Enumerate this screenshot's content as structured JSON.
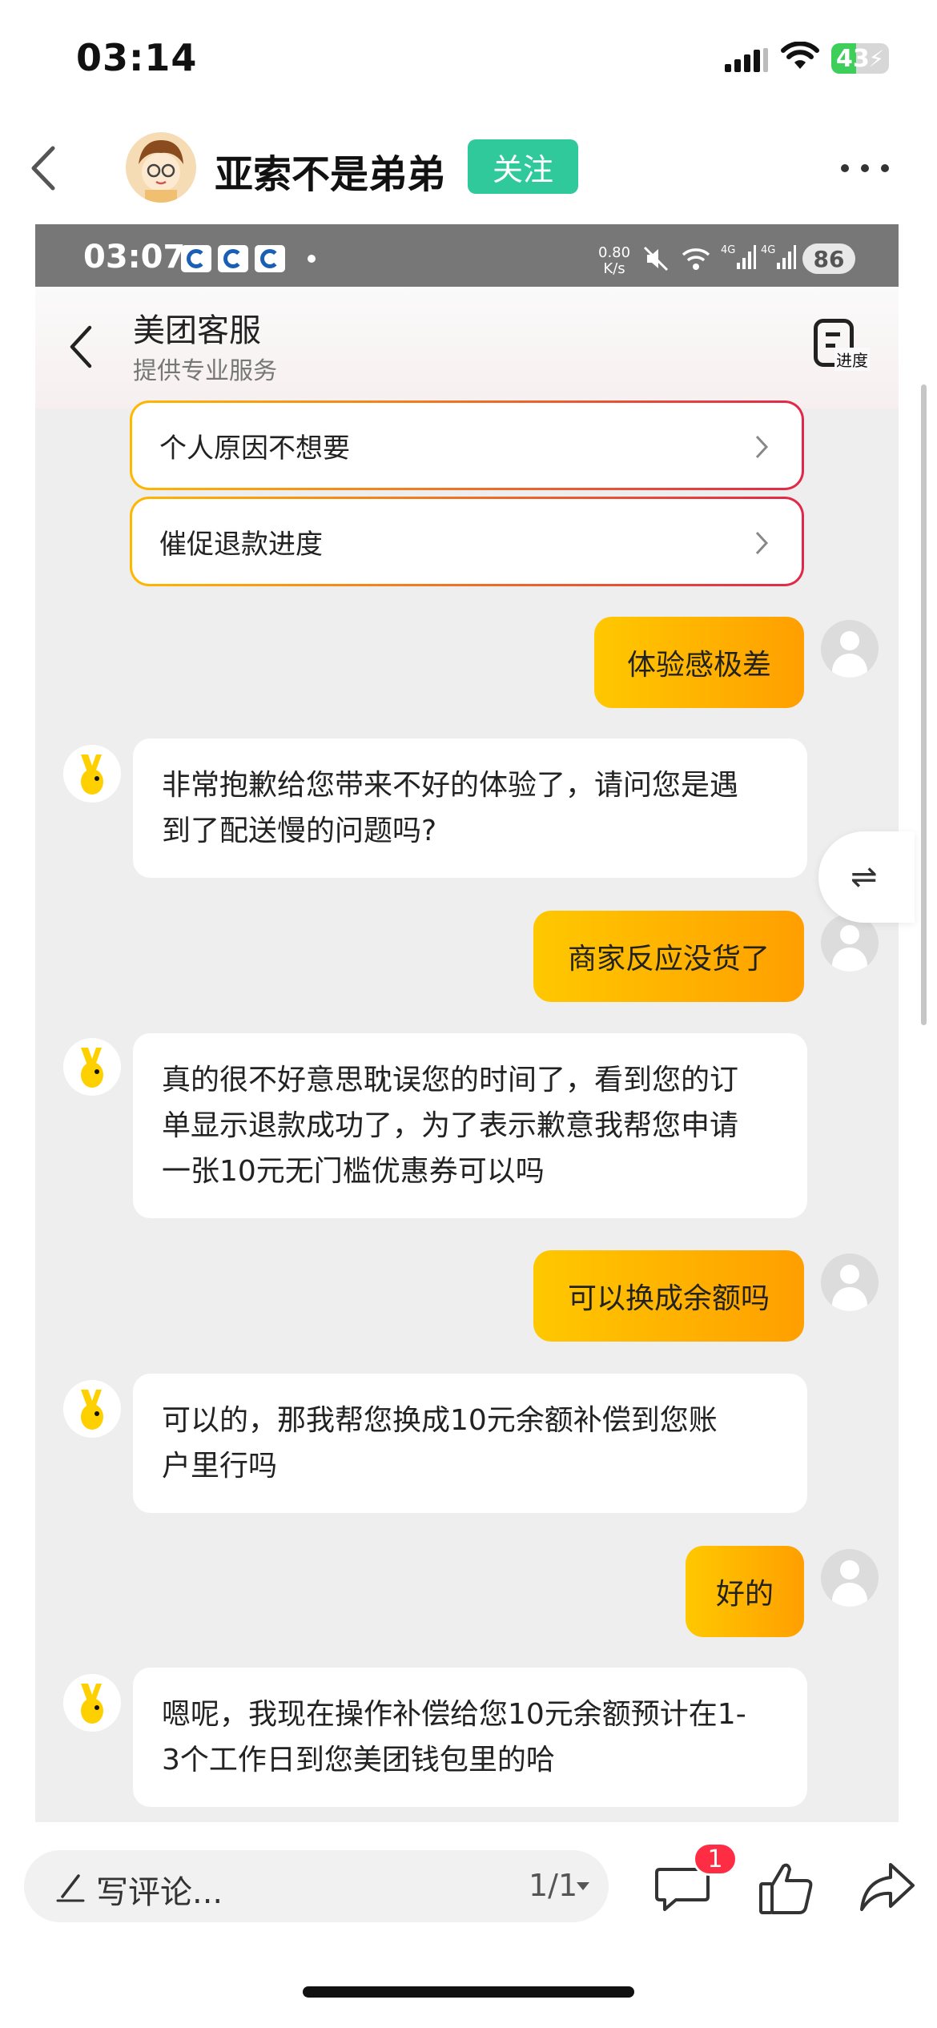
{
  "status_bar": {
    "time": "03:14",
    "battery": "43",
    "battery_level": 0.43
  },
  "post": {
    "username": "亚索不是弟弟",
    "follow_label": "关注"
  },
  "embedded": {
    "status": {
      "time": "03:07",
      "speed_top": "0.80",
      "speed_unit": "K/s",
      "battery": "86"
    },
    "header": {
      "title": "美团客服",
      "subtitle": "提供专业服务",
      "progress_label": "进度"
    },
    "options": [
      "个人原因不想要",
      "催促退款进度"
    ],
    "messages": [
      {
        "from": "user",
        "text": "体验感极差"
      },
      {
        "from": "bot",
        "lines": [
          "非常抱歉给您带来不好的体验了，请问您是遇",
          "到了配送慢的问题吗?"
        ]
      },
      {
        "from": "user",
        "text": "商家反应没货了"
      },
      {
        "from": "bot",
        "lines": [
          "真的很不好意思耽误您的时间了，看到您的订",
          "单显示退款成功了，为了表示歉意我帮您申请",
          "一张10元无门槛优惠券可以吗"
        ]
      },
      {
        "from": "user",
        "text": "可以换成余额吗"
      },
      {
        "from": "bot",
        "lines": [
          "可以的，那我帮您换成10元余额补偿到您账",
          "户里行吗"
        ]
      },
      {
        "from": "user",
        "text": "好的"
      },
      {
        "from": "bot",
        "lines": [
          "嗯呢，我现在操作补偿给您10元余额预计在1-",
          "3个工作日到您美团钱包里的哈"
        ]
      }
    ],
    "switch_icon": "⇌"
  },
  "bottom_bar": {
    "comment_placeholder": "写评论...",
    "pager": "1/1",
    "comment_badge": "1"
  },
  "colors": {
    "follow": "#2fc99b",
    "user_bubble_start": "#ffc800",
    "user_bubble_end": "#ff9f00",
    "badge": "#ff2d43"
  }
}
